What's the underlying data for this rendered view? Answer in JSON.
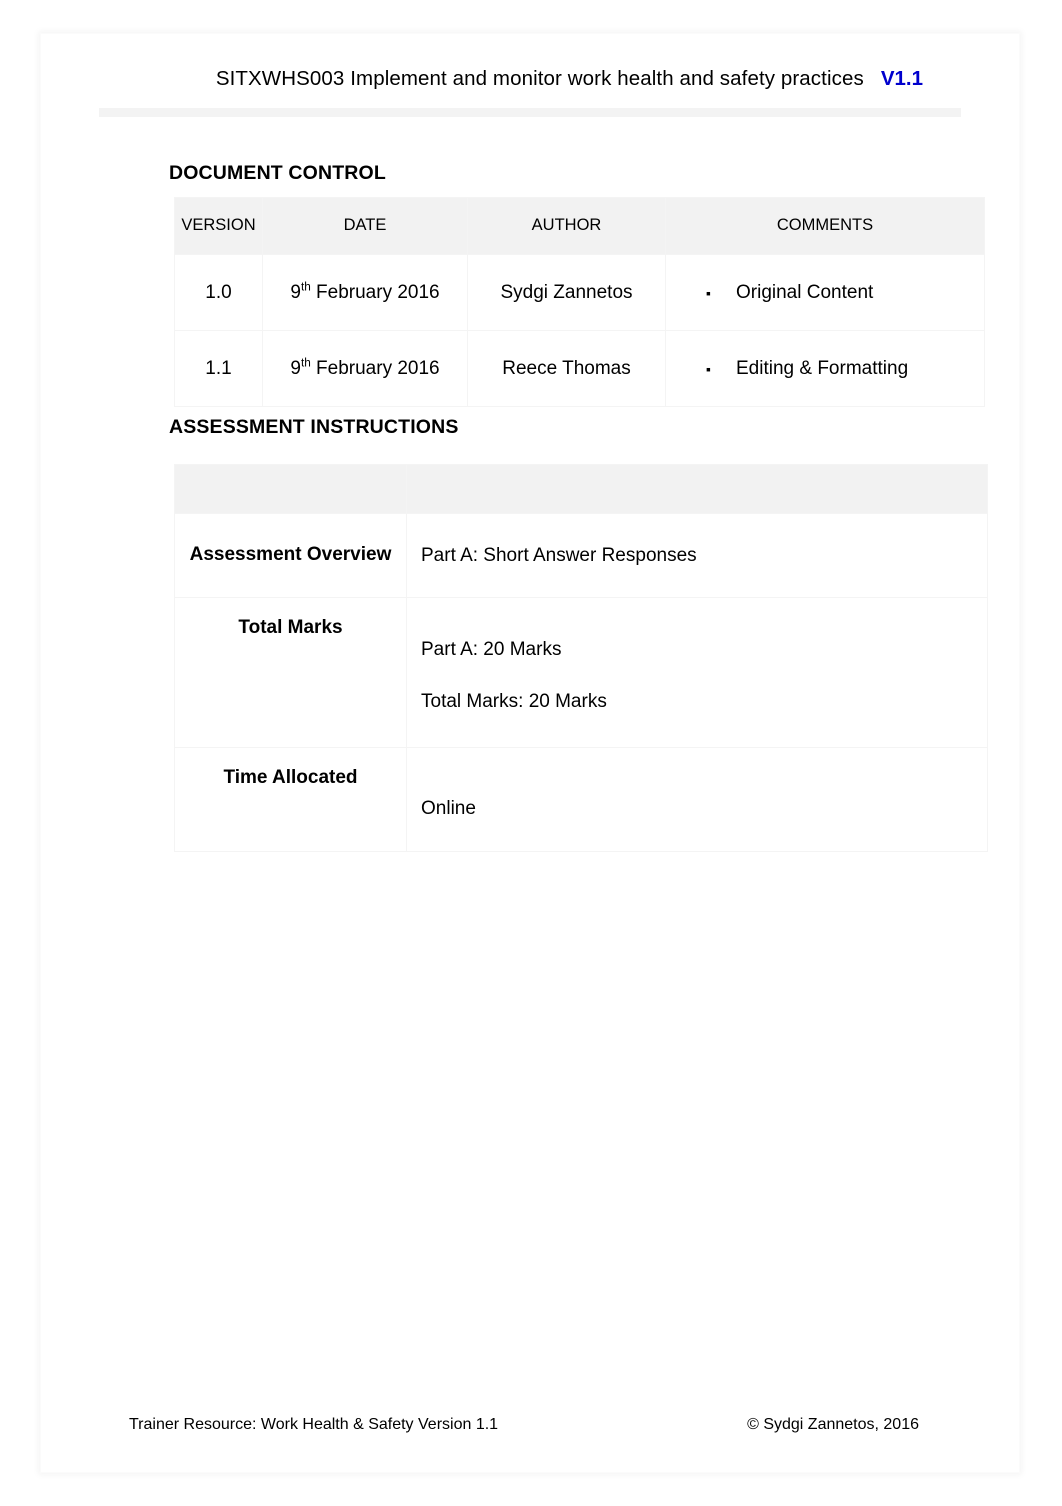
{
  "header": {
    "title": "SITXWHS003 Implement and monitor work health and safety practices",
    "version_label": "V1.1",
    "version_color": "#0000cd"
  },
  "sections": {
    "document_control": {
      "heading": "DOCUMENT CONTROL",
      "columns": [
        "VERSION",
        "DATE",
        "AUTHOR",
        "COMMENTS"
      ],
      "rows": [
        {
          "version": "1.0",
          "date_day": "9",
          "date_ordinal": "th",
          "date_rest": " February 2016",
          "author": "Sydgi Zannetos",
          "bullet": "▪",
          "comment": "Original Content"
        },
        {
          "version": "1.1",
          "date_day": "9",
          "date_ordinal": "th",
          "date_rest": " February 2016",
          "author": "Reece Thomas",
          "bullet": "▪",
          "comment": "Editing & Formatting"
        }
      ]
    },
    "assessment_instructions": {
      "heading": "ASSESSMENT INSTRUCTIONS",
      "header_row": {
        "label": "",
        "value": ""
      },
      "rows": [
        {
          "label": "Assessment Overview",
          "value_lines": [
            "Part A: Short Answer Responses"
          ]
        },
        {
          "label": "Total Marks",
          "value_lines": [
            "Part A: 20 Marks",
            "Total Marks: 20 Marks"
          ]
        },
        {
          "label": "Time Allocated",
          "value_lines": [
            "Online"
          ]
        }
      ]
    }
  },
  "footer": {
    "left": "Trainer Resource: Work Health & Safety Version 1.1",
    "right": "© Sydgi Zannetos, 2016"
  }
}
